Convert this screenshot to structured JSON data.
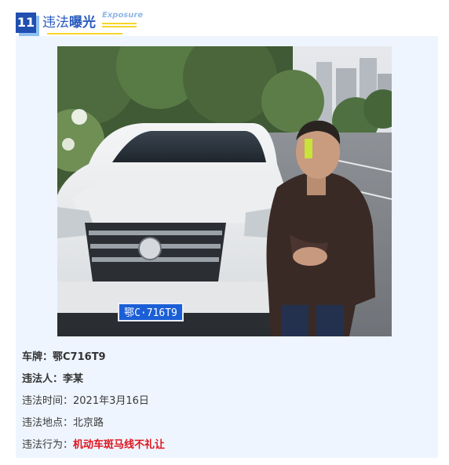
{
  "header": {
    "number": "11",
    "title_plain": "违法",
    "title_bold": "曝光",
    "subtitle_en": "Exposure"
  },
  "photo": {
    "plate_text": "鄂C·716T9"
  },
  "info": {
    "plate_label": "车牌：",
    "plate_value": "鄂C716T9",
    "person_label": "违法人：",
    "person_value": "李某",
    "time_label": "违法时间：",
    "time_value": "2021年3月16日",
    "place_label": "违法地点：",
    "place_value": "北京路",
    "act_label": "违法行为：",
    "act_value": "机动车斑马线不礼让"
  },
  "colors": {
    "badge": "#1f4fb0",
    "panel": "#eef5fe",
    "violation_red": "#e0141e",
    "accent_yellow": "#f5d42a"
  }
}
